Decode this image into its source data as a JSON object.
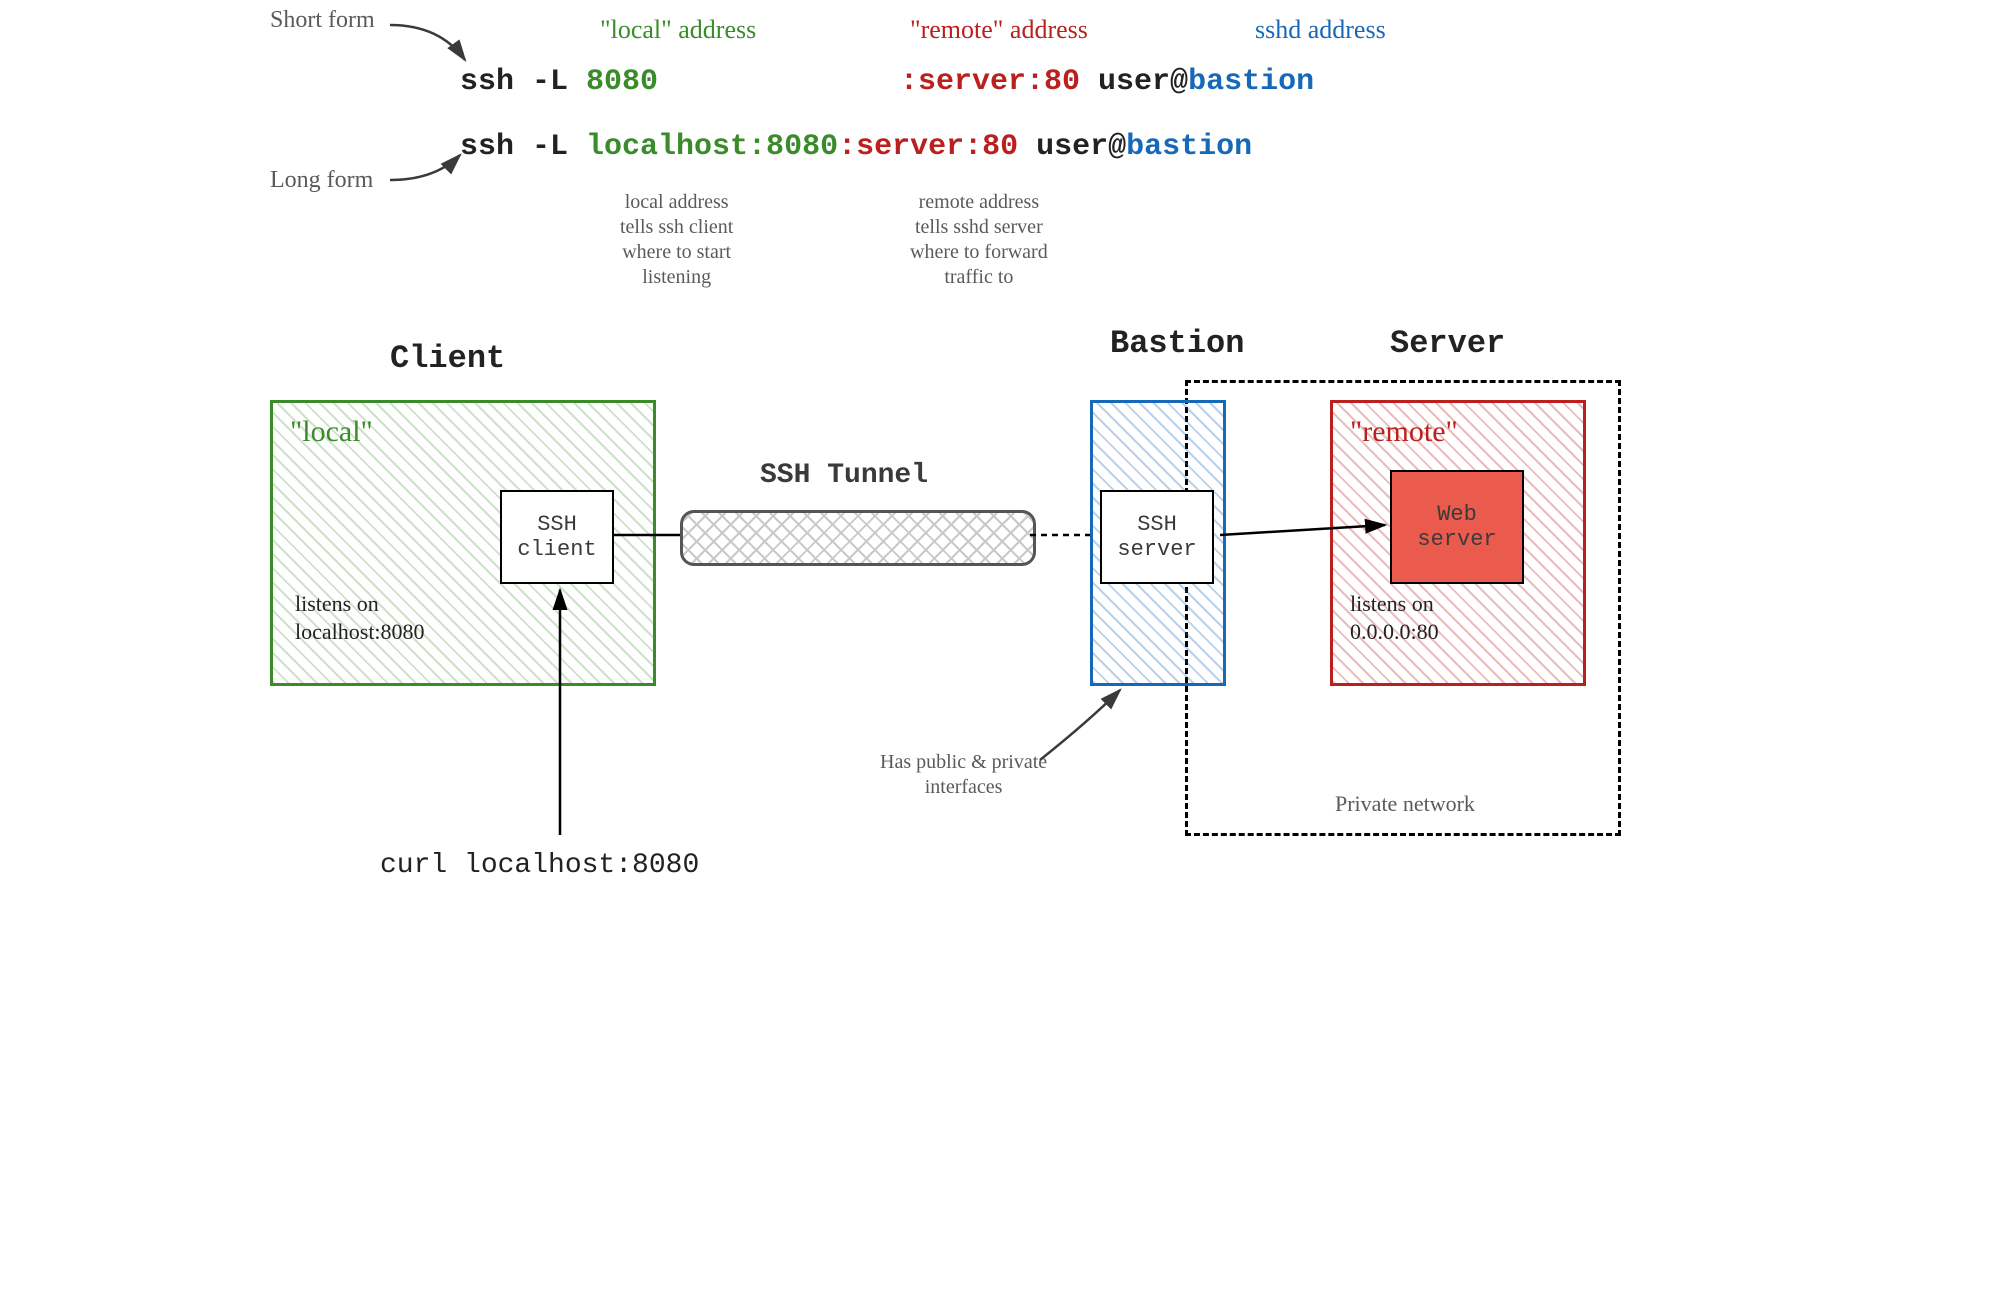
{
  "annotations": {
    "short_form": "Short form",
    "long_form": "Long form",
    "local_label": "\"local\" address",
    "remote_label": "\"remote\" address",
    "sshd_label": "sshd address",
    "local_note": "local address\ntells ssh client\nwhere to start\nlistening",
    "remote_note": "remote address\ntells sshd server\nwhere to forward\ntraffic to",
    "bastion_note": "Has public & private\ninterfaces",
    "private_network": "Private network"
  },
  "commands": {
    "line1": {
      "ssh": "ssh -L ",
      "local": "8080",
      "sep": ":",
      "remote": "server:80",
      "user": " user@",
      "host": "bastion"
    },
    "line2": {
      "ssh": "ssh -L ",
      "local": "localhost:8080",
      "sep": ":",
      "remote": "server:80",
      "user": " user@",
      "host": "bastion"
    },
    "curl": "curl localhost:8080"
  },
  "diagram": {
    "client_title": "Client",
    "bastion_title": "Bastion",
    "server_title": "Server",
    "tunnel_label": "SSH Tunnel",
    "local_box_label": "\"local\"",
    "remote_box_label": "\"remote\"",
    "ssh_client": "SSH\nclient",
    "ssh_server": "SSH\nserver",
    "web_server": "Web\nserver",
    "local_listen": "listens on\nlocalhost:8080",
    "remote_listen": "listens on\n0.0.0.0:80"
  }
}
